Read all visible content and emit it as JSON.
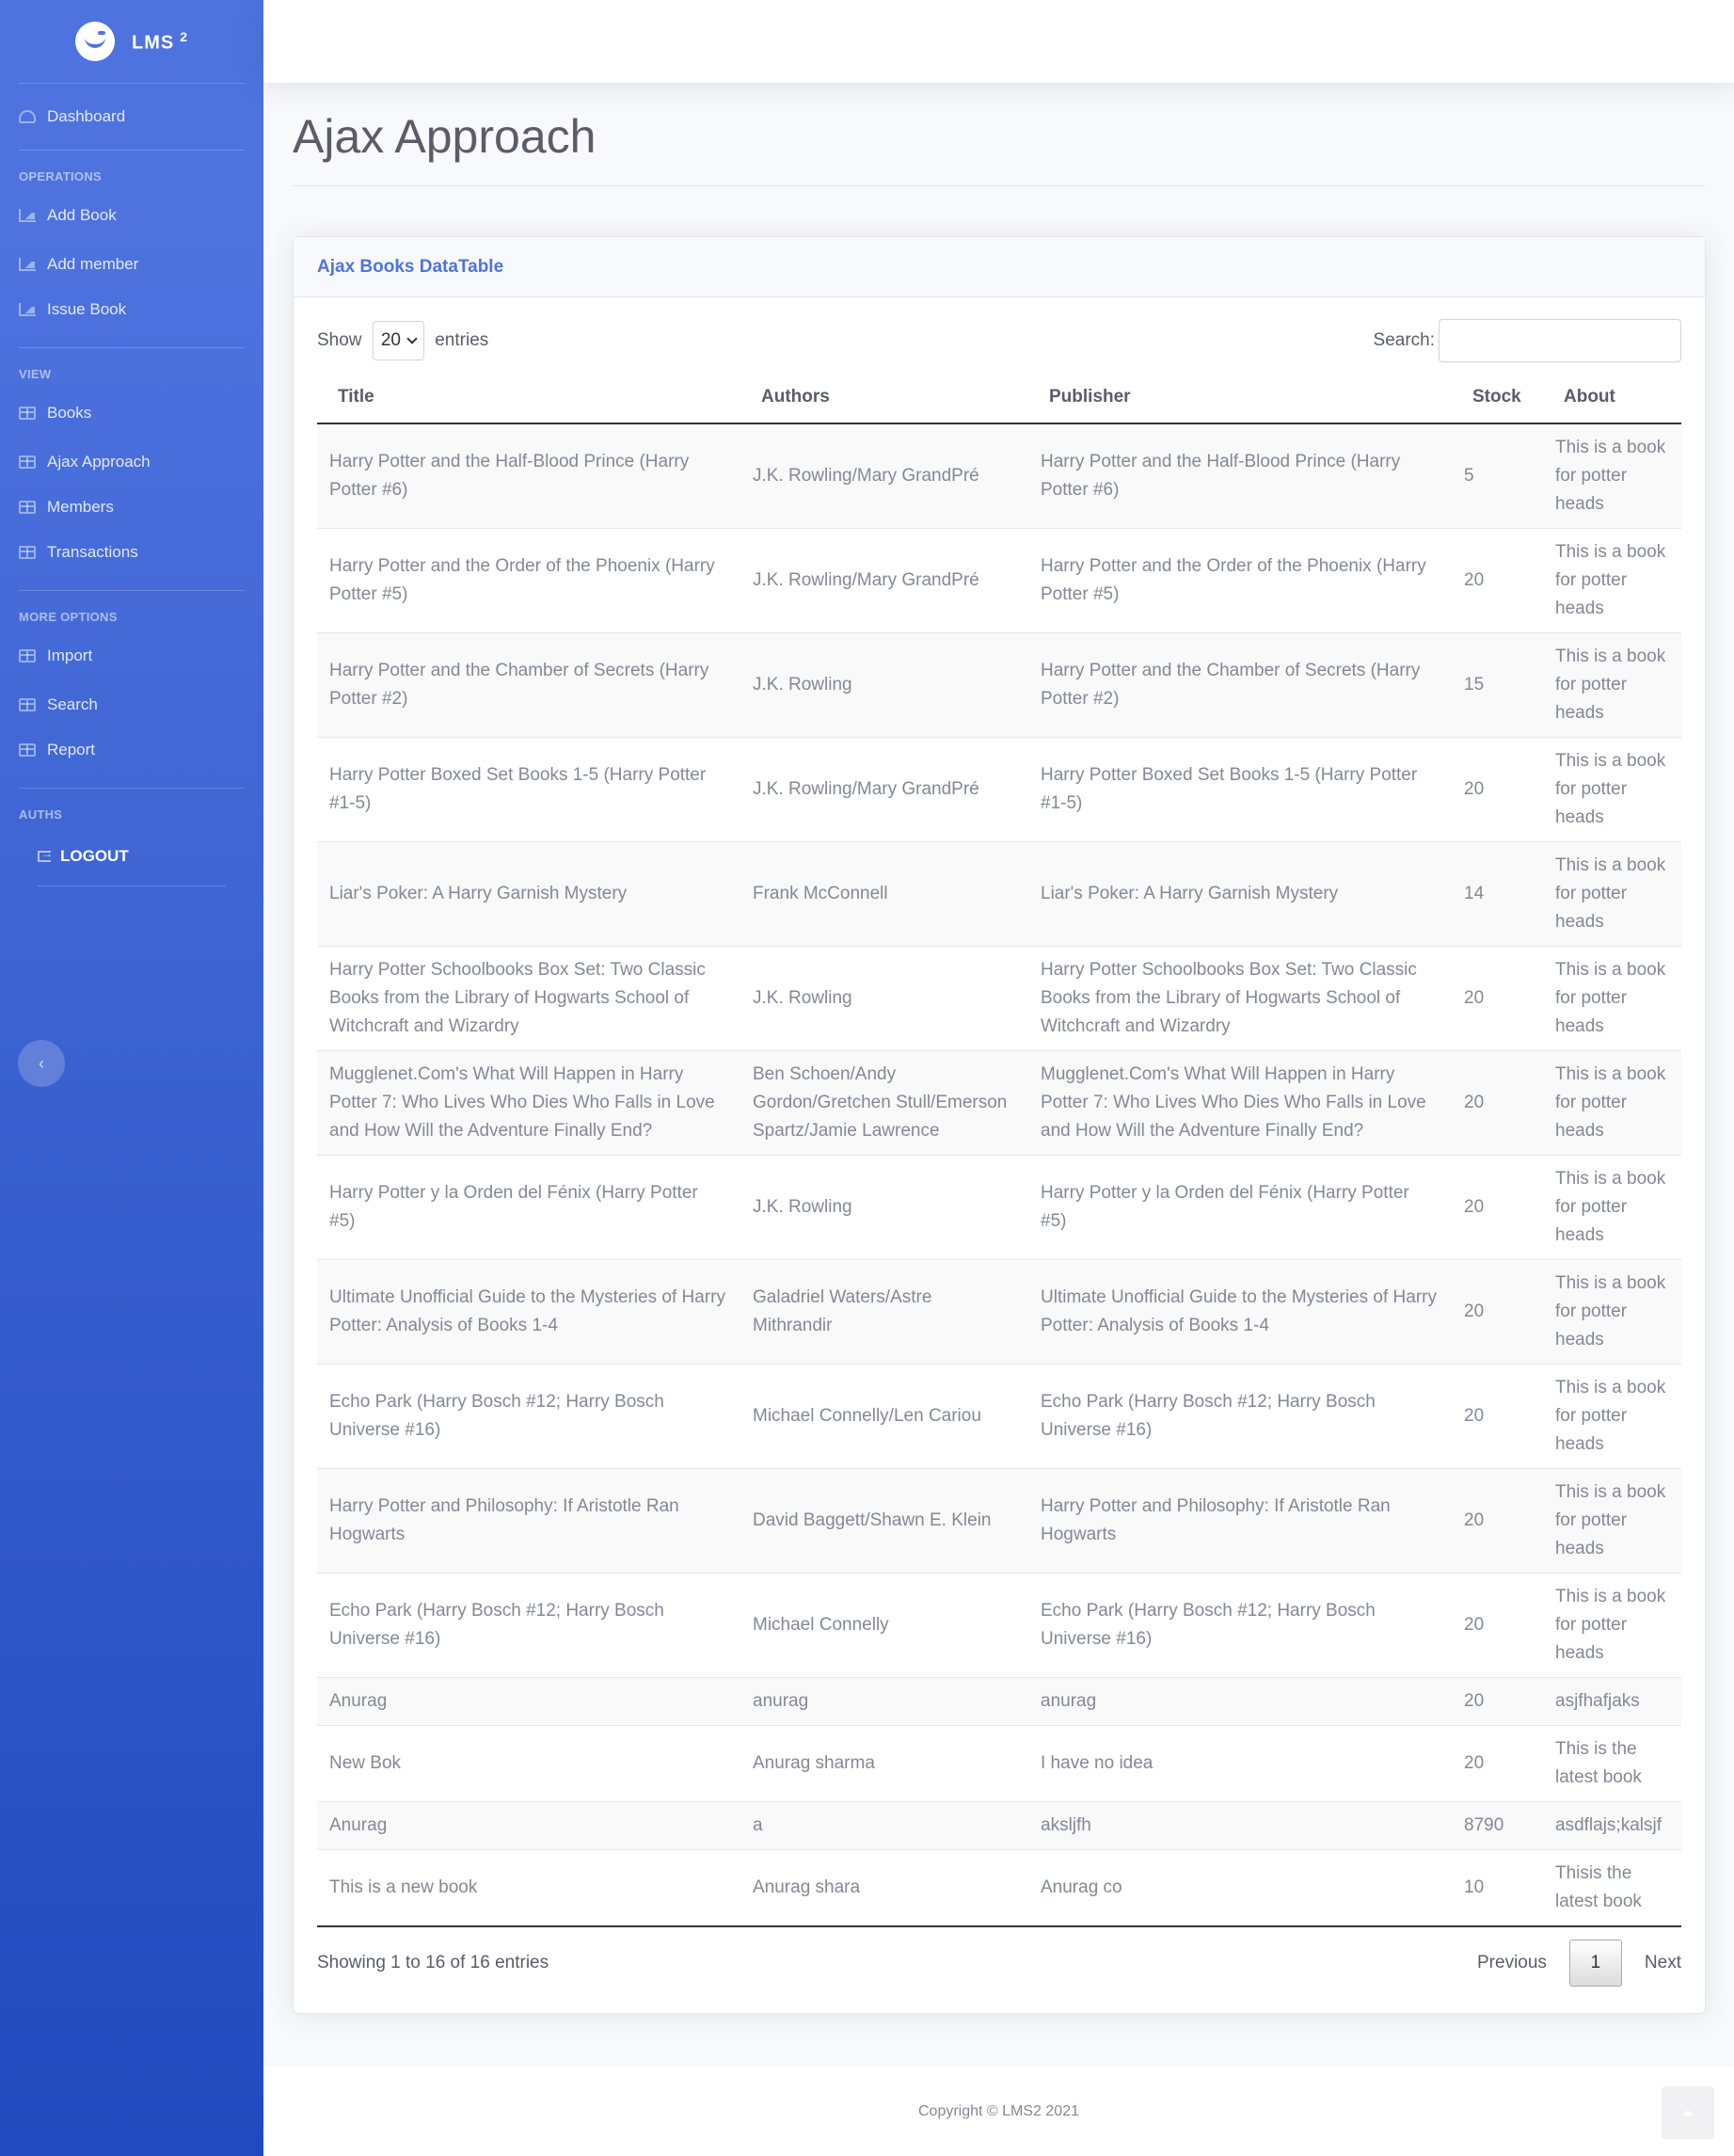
{
  "brand": {
    "name": "LMS",
    "sup": "2"
  },
  "sidebar": {
    "dashboard": "Dashboard",
    "sections": {
      "operations": "OPERATIONS",
      "view": "VIEW",
      "more": "MORE OPTIONS",
      "auths": "AUTHS"
    },
    "operations": [
      "Add Book",
      "Add member",
      "Issue Book"
    ],
    "view": [
      "Books",
      "Ajax Approach",
      "Members",
      "Transactions"
    ],
    "more": [
      "Import",
      "Search",
      "Report"
    ],
    "logout": "LOGOUT",
    "toggle": "‹"
  },
  "page": {
    "title": "Ajax Approach"
  },
  "card": {
    "title": "Ajax Books DataTable"
  },
  "table": {
    "show_label": "Show",
    "length": "20",
    "entries_label": "entries",
    "search_label": "Search:",
    "search_value": "",
    "headers": [
      "Title",
      "Authors",
      "Publisher",
      "Stock",
      "About"
    ],
    "rows": [
      [
        "Harry Potter and the Half-Blood Prince (Harry Potter #6)",
        "J.K. Rowling/Mary GrandPré",
        "Harry Potter and the Half-Blood Prince (Harry Potter #6)",
        "5",
        "This is a book for potter heads"
      ],
      [
        "Harry Potter and the Order of the Phoenix (Harry Potter #5)",
        "J.K. Rowling/Mary GrandPré",
        "Harry Potter and the Order of the Phoenix (Harry Potter #5)",
        "20",
        "This is a book for potter heads"
      ],
      [
        "Harry Potter and the Chamber of Secrets (Harry Potter #2)",
        "J.K. Rowling",
        "Harry Potter and the Chamber of Secrets (Harry Potter #2)",
        "15",
        "This is a book for potter heads"
      ],
      [
        "Harry Potter Boxed Set Books 1-5 (Harry Potter #1-5)",
        "J.K. Rowling/Mary GrandPré",
        "Harry Potter Boxed Set Books 1-5 (Harry Potter #1-5)",
        "20",
        "This is a book for potter heads"
      ],
      [
        "Liar's Poker: A Harry Garnish Mystery",
        "Frank McConnell",
        "Liar's Poker: A Harry Garnish Mystery",
        "14",
        "This is a book for potter heads"
      ],
      [
        "Harry Potter Schoolbooks Box Set: Two Classic Books from the Library of Hogwarts School of Witchcraft and Wizardry",
        "J.K. Rowling",
        "Harry Potter Schoolbooks Box Set: Two Classic Books from the Library of Hogwarts School of Witchcraft and Wizardry",
        "20",
        "This is a book for potter heads"
      ],
      [
        "Mugglenet.Com's What Will Happen in Harry Potter 7: Who Lives Who Dies Who Falls in Love and How Will the Adventure Finally End?",
        "Ben Schoen/Andy Gordon/Gretchen Stull/Emerson Spartz/Jamie Lawrence",
        "Mugglenet.Com's What Will Happen in Harry Potter 7: Who Lives Who Dies Who Falls in Love and How Will the Adventure Finally End?",
        "20",
        "This is a book for potter heads"
      ],
      [
        "Harry Potter y la Orden del Fénix (Harry Potter #5)",
        "J.K. Rowling",
        "Harry Potter y la Orden del Fénix (Harry Potter #5)",
        "20",
        "This is a book for potter heads"
      ],
      [
        "Ultimate Unofficial Guide to the Mysteries of Harry Potter: Analysis of Books 1-4",
        "Galadriel Waters/Astre Mithrandir",
        "Ultimate Unofficial Guide to the Mysteries of Harry Potter: Analysis of Books 1-4",
        "20",
        "This is a book for potter heads"
      ],
      [
        "Echo Park (Harry Bosch #12; Harry Bosch Universe #16)",
        "Michael Connelly/Len Cariou",
        "Echo Park (Harry Bosch #12; Harry Bosch Universe #16)",
        "20",
        "This is a book for potter heads"
      ],
      [
        "Harry Potter and Philosophy: If Aristotle Ran Hogwarts",
        "David Baggett/Shawn E. Klein",
        "Harry Potter and Philosophy: If Aristotle Ran Hogwarts",
        "20",
        "This is a book for potter heads"
      ],
      [
        "Echo Park (Harry Bosch #12; Harry Bosch Universe #16)",
        "Michael Connelly",
        "Echo Park (Harry Bosch #12; Harry Bosch Universe #16)",
        "20",
        "This is a book for potter heads"
      ],
      [
        "Anurag",
        "anurag",
        "anurag",
        "20",
        "asjfhafjaks"
      ],
      [
        "New Bok",
        "Anurag sharma",
        "I have no idea",
        "20",
        "This is the latest book"
      ],
      [
        "Anurag",
        "a",
        "aksljfh",
        "8790",
        "asdflajs;kalsjf"
      ],
      [
        "This is a new book",
        "Anurag shara",
        "Anurag co",
        "10",
        "Thisis the latest book"
      ]
    ],
    "info": "Showing 1 to 16 of 16 entries",
    "pager": {
      "previous": "Previous",
      "current": "1",
      "next": "Next"
    }
  },
  "footer": {
    "copyright": "Copyright © LMS2 2021"
  }
}
